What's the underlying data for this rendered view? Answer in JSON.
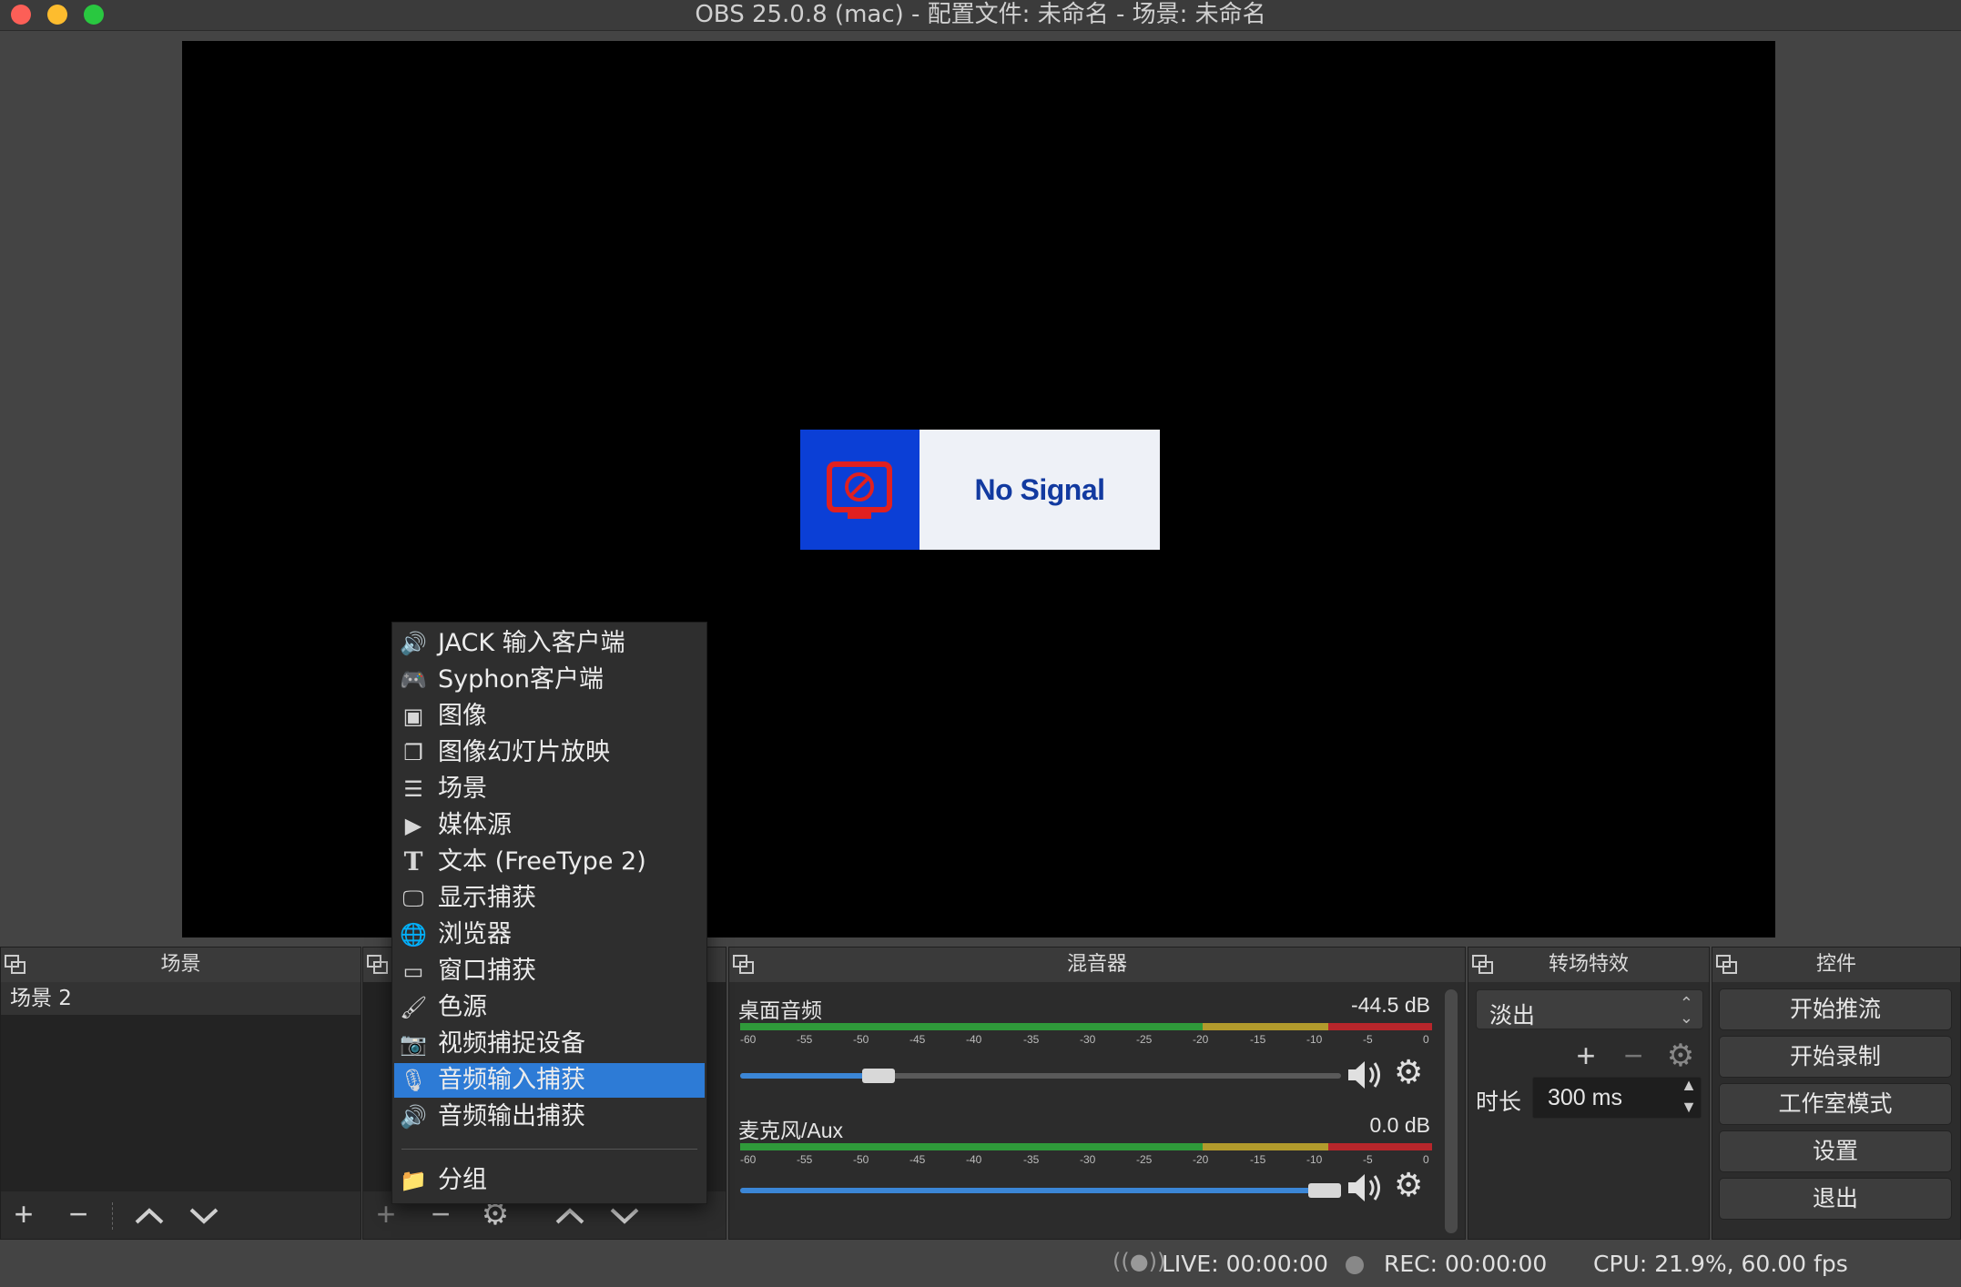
{
  "window": {
    "title": "OBS 25.0.8 (mac) - 配置文件: 未命名 - 场景: 未命名"
  },
  "preview": {
    "no_signal_text": "No Signal"
  },
  "scenes": {
    "header": "场景",
    "items": [
      "场景 2"
    ]
  },
  "sources_menu": {
    "items": [
      {
        "label": "JACK 输入客户端",
        "icon": "speaker-icon"
      },
      {
        "label": "Syphon客户端",
        "icon": "gamepad-icon"
      },
      {
        "label": "图像",
        "icon": "image-icon"
      },
      {
        "label": "图像幻灯片放映",
        "icon": "slideshow-icon"
      },
      {
        "label": "场景",
        "icon": "list-icon"
      },
      {
        "label": "媒体源",
        "icon": "play-icon"
      },
      {
        "label": "文本 (FreeType 2)",
        "icon": "text-icon"
      },
      {
        "label": "显示捕获",
        "icon": "monitor-icon"
      },
      {
        "label": "浏览器",
        "icon": "globe-icon"
      },
      {
        "label": "窗口捕获",
        "icon": "window-icon"
      },
      {
        "label": "色源",
        "icon": "brush-icon"
      },
      {
        "label": "视频捕捉设备",
        "icon": "camera-icon"
      },
      {
        "label": "音频输入捕获",
        "icon": "microphone-icon",
        "selected": true
      },
      {
        "label": "音频输出捕获",
        "icon": "speaker-icon"
      },
      {
        "label": "分组",
        "icon": "folder-icon"
      }
    ]
  },
  "mixer": {
    "header": "混音器",
    "scale_labels": [
      "-60",
      "-55",
      "-50",
      "-45",
      "-40",
      "-35",
      "-30",
      "-25",
      "-20",
      "-15",
      "-10",
      "-5",
      "0"
    ],
    "channels": [
      {
        "name": "桌面音频",
        "level": "-44.5 dB",
        "volume_fraction": 0.23
      },
      {
        "name": "麦克风/Aux",
        "level": "0.0 dB",
        "volume_fraction": 1.0
      }
    ]
  },
  "transitions": {
    "header": "转场特效",
    "selected": "淡出",
    "duration_label": "时长",
    "duration_value": "300 ms"
  },
  "controls": {
    "header": "控件",
    "buttons": [
      "开始推流",
      "开始录制",
      "工作室模式",
      "设置",
      "退出"
    ]
  },
  "status": {
    "live": "LIVE: 00:00:00",
    "rec": "REC: 00:00:00",
    "cpu": "CPU: 21.9%, 60.00 fps"
  },
  "colors": {
    "selection": "#2d7bd6",
    "meter_green": "#2f9a3a",
    "meter_yellow": "#b29b2c",
    "meter_red": "#b8262b",
    "slider_blue": "#3b86d6"
  }
}
